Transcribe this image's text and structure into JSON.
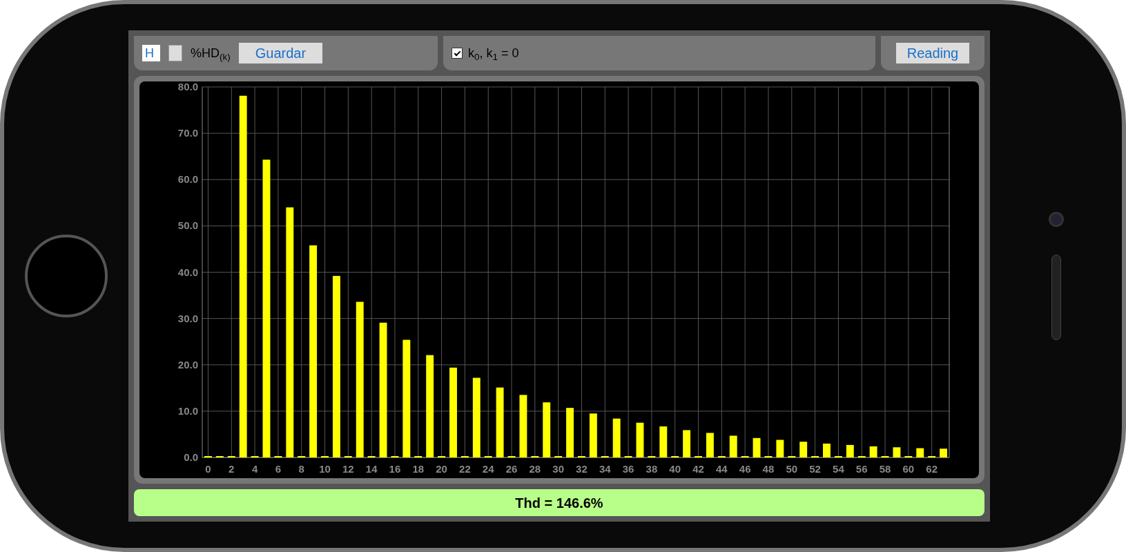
{
  "controls": {
    "harmonic_field": {
      "value": "H"
    },
    "unit_label": "%HD$_{(k)}$",
    "save_button": "Guardar",
    "zero_checkbox": {
      "label": "k$_{0}$, k$_{1}$ = 0",
      "checked": true
    },
    "reading_button": "Reading"
  },
  "chart": {
    "chart_data": {
      "type": "bar",
      "grid": true,
      "x": [
        0,
        1,
        2,
        3,
        4,
        5,
        6,
        7,
        8,
        9,
        10,
        11,
        12,
        13,
        14,
        15,
        16,
        17,
        18,
        19,
        20,
        21,
        22,
        23,
        24,
        25,
        26,
        27,
        28,
        29,
        30,
        31,
        32,
        33,
        34,
        35,
        36,
        37,
        38,
        39,
        40,
        41,
        42,
        43,
        44,
        45,
        46,
        47,
        48,
        49,
        50,
        51,
        52,
        53,
        54,
        55,
        56,
        57,
        58,
        59,
        60,
        61,
        62,
        63
      ],
      "series": [
        {
          "color": "#ffff00",
          "values": [
            0.3,
            0.3,
            0.3,
            78.1,
            0.3,
            64.3,
            0.3,
            54.0,
            0.3,
            45.8,
            0.3,
            39.2,
            0.3,
            33.6,
            0.3,
            29.1,
            0.3,
            25.4,
            0.3,
            22.1,
            0.3,
            19.4,
            0.3,
            17.2,
            0.3,
            15.1,
            0.3,
            13.5,
            0.3,
            11.9,
            0.3,
            10.7,
            0.3,
            9.5,
            0.3,
            8.4,
            0.3,
            7.5,
            0.3,
            6.7,
            0.3,
            5.9,
            0.3,
            5.3,
            0.3,
            4.7,
            0.3,
            4.2,
            0.3,
            3.8,
            0.3,
            3.4,
            0.3,
            3.0,
            0.3,
            2.7,
            0.3,
            2.4,
            0.3,
            2.2,
            0.3,
            2.0,
            0.3,
            1.9
          ]
        }
      ],
      "xlim": [
        -0.5,
        63.5
      ],
      "ylim": [
        0,
        80
      ],
      "yticks": [
        {
          "value": 0,
          "label": "0.0"
        },
        {
          "value": 10,
          "label": "10.0"
        },
        {
          "value": 20,
          "label": "20.0"
        },
        {
          "value": 30,
          "label": "30.0"
        },
        {
          "value": 40,
          "label": "40.0"
        },
        {
          "value": 50,
          "label": "50.0"
        },
        {
          "value": 60,
          "label": "60.0"
        },
        {
          "value": 70,
          "label": "70.0"
        },
        {
          "value": 80,
          "label": "80.0"
        }
      ],
      "xticks": [
        0,
        2,
        4,
        6,
        8,
        10,
        12,
        14,
        16,
        18,
        20,
        22,
        24,
        26,
        28,
        30,
        32,
        34,
        36,
        38,
        40,
        42,
        44,
        46,
        48,
        50,
        52,
        54,
        56,
        58,
        60,
        62
      ]
    }
  },
  "thd_bar": {
    "text": "Thd = 146.6%"
  }
}
